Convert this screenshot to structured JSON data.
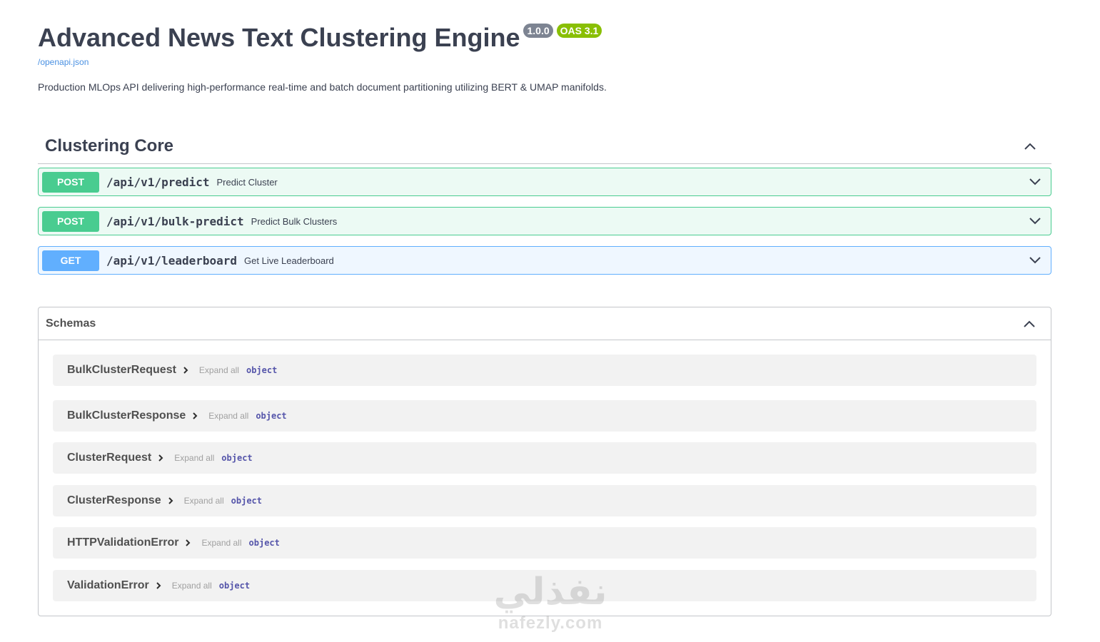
{
  "info": {
    "title": "Advanced News Text Clustering Engine",
    "version": "1.0.0",
    "oas": "OAS 3.1",
    "spec_link": "/openapi.json",
    "description": "Production MLOps API delivering high-performance real-time and batch document partitioning utilizing BERT & UMAP manifolds."
  },
  "tag": {
    "name": "Clustering Core",
    "operations": [
      {
        "method": "POST",
        "path": "/api/v1/predict",
        "summary": "Predict Cluster"
      },
      {
        "method": "POST",
        "path": "/api/v1/bulk-predict",
        "summary": "Predict Bulk Clusters"
      },
      {
        "method": "GET",
        "path": "/api/v1/leaderboard",
        "summary": "Get Live Leaderboard"
      }
    ]
  },
  "schemas": {
    "title": "Schemas",
    "items": [
      {
        "name": "BulkClusterRequest",
        "expand": "Expand all",
        "type": "object"
      },
      {
        "name": "BulkClusterResponse",
        "expand": "Expand all",
        "type": "object"
      },
      {
        "name": "ClusterRequest",
        "expand": "Expand all",
        "type": "object"
      },
      {
        "name": "ClusterResponse",
        "expand": "Expand all",
        "type": "object"
      },
      {
        "name": "HTTPValidationError",
        "expand": "Expand all",
        "type": "object"
      },
      {
        "name": "ValidationError",
        "expand": "Expand all",
        "type": "object"
      }
    ]
  },
  "watermark": {
    "arabic": "نفذلي",
    "latin": "nafezly.com"
  },
  "colors": {
    "post": "#49cc90",
    "get": "#61affe",
    "version_badge": "#7d8492",
    "oas_badge": "#89bf04",
    "link": "#4990e2"
  }
}
